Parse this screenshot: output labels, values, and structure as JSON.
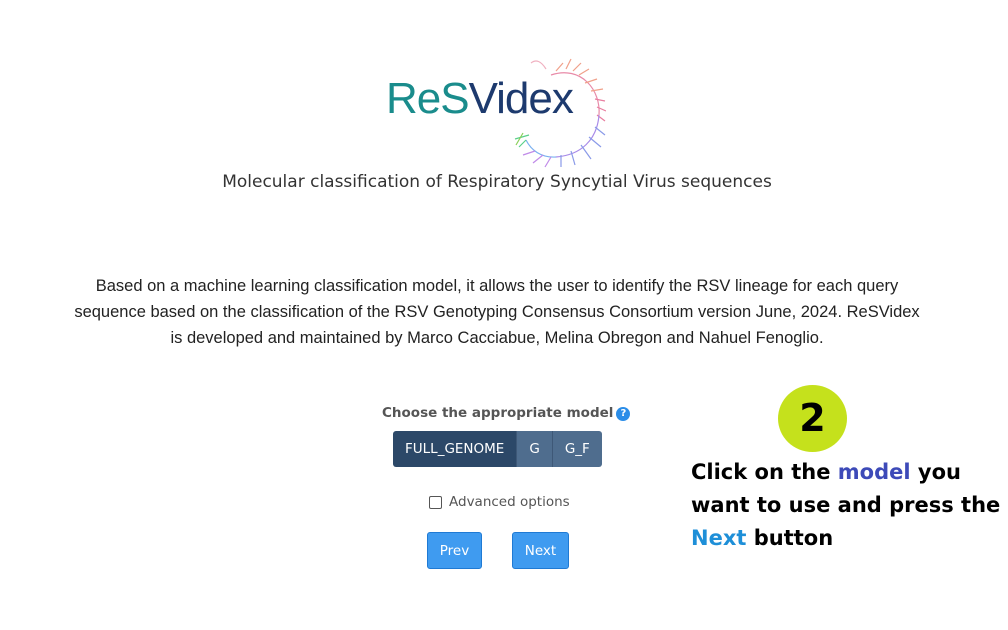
{
  "logo": {
    "part1": "ReS",
    "part2": "V",
    "part3": "idex"
  },
  "subtitle": "Molecular classification of Respiratory Syncytial Virus sequences",
  "description": "Based on a machine learning classification model, it allows the user to identify the RSV lineage for each query sequence based on the classification of the RSV Genotyping Consensus Consortium version June, 2024. ReSVidex is developed and maintained by Marco Cacciabue, Melina Obregon and Nahuel Fenoglio.",
  "model_selector": {
    "label": "Choose the appropriate model",
    "help_icon": "?",
    "options": [
      "FULL_GENOME",
      "G",
      "G_F"
    ],
    "selected": "FULL_GENOME"
  },
  "advanced_options": {
    "label": "Advanced options",
    "checked": false
  },
  "buttons": {
    "prev": "Prev",
    "next": "Next"
  },
  "annotation": {
    "step_number": "2",
    "text_1": "Click on the ",
    "highlight_model": "model",
    "text_2": " you want to use and press the ",
    "highlight_next": "Next",
    "text_3": " button"
  },
  "colors": {
    "logo_teal": "#1a8c8c",
    "logo_navy": "#1d3a6e",
    "button_group": "#4f6d8e",
    "button_group_active": "#2c4868",
    "primary_button": "#3f9bf0",
    "badge": "#c5e11c",
    "highlight_model": "#3d4ab8",
    "highlight_next": "#1e8fd8"
  }
}
